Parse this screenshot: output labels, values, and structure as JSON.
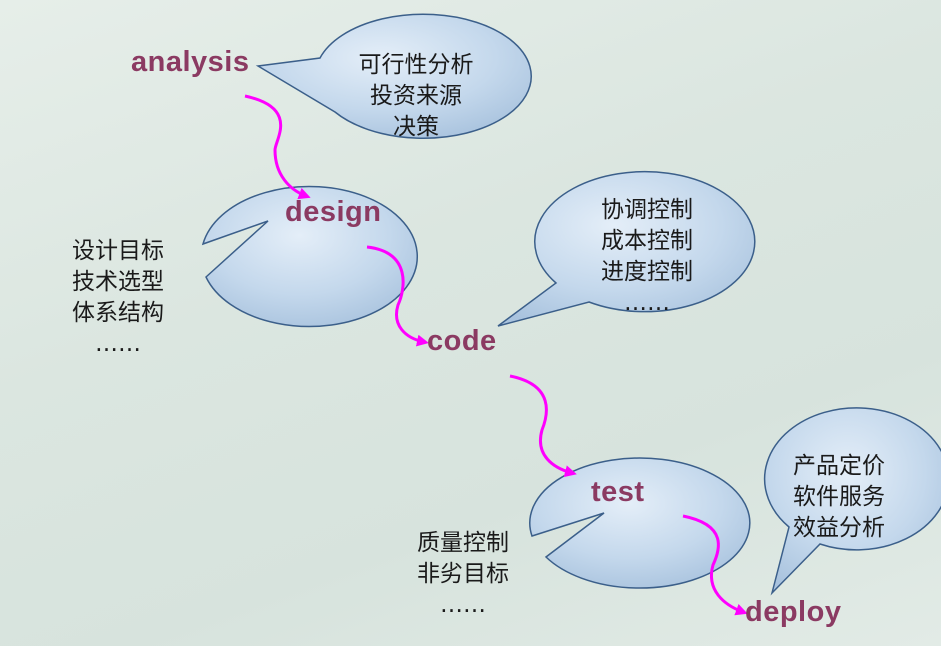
{
  "stages": {
    "analysis": "analysis",
    "design": "design",
    "code": "code",
    "test": "test",
    "deploy": "deploy"
  },
  "bubbles": {
    "analysis": [
      "可行性分析",
      "投资来源",
      "决策"
    ],
    "design": [
      "设计目标",
      "技术选型",
      "体系结构",
      "……"
    ],
    "code": [
      "协调控制",
      "成本控制",
      "进度控制",
      "……"
    ],
    "test": [
      "质量控制",
      "非劣目标",
      "……"
    ],
    "deploy": [
      "产品定价",
      "软件服务",
      "效益分析"
    ]
  },
  "colors": {
    "stage_text": "#8b3a62",
    "arrow": "#ff00ff",
    "bubble_fill": "#bcd3e9",
    "bubble_stroke": "#3b5f8a"
  }
}
